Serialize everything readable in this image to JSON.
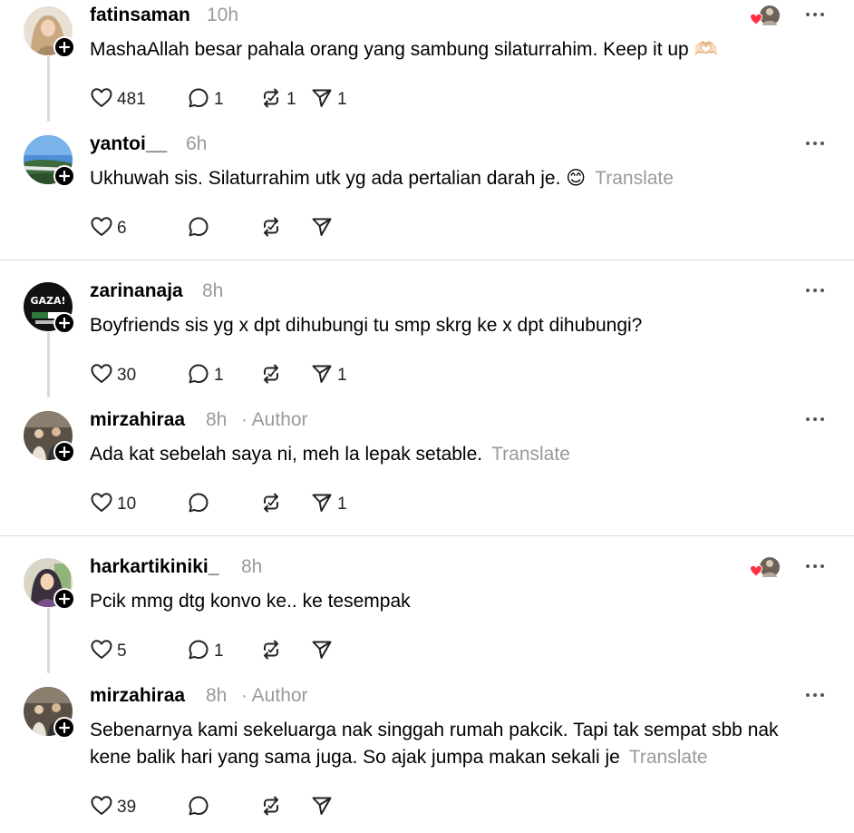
{
  "posts": [
    {
      "username": "fatinsaman",
      "time": "10h",
      "author_label": "",
      "text": "MashaAllah besar pahala orang yang sambung silaturrahim. Keep it up 🫶🏻",
      "translate": "",
      "likes": "481",
      "replies": "1",
      "reposts": "1",
      "shares": "1",
      "liked_by_author": true,
      "avatar": "avatar-hijab-woman"
    },
    {
      "username": "yantoi__",
      "time": "6h",
      "author_label": "",
      "text": "Ukhuwah sis. Silaturrahim utk yg ada pertalian darah je. 😊",
      "translate": "Translate",
      "likes": "6",
      "replies": "",
      "reposts": "",
      "shares": "",
      "liked_by_author": false,
      "avatar": "avatar-landscape"
    },
    {
      "username": "zarinanaja",
      "time": "8h",
      "author_label": "",
      "text": "Boyfriends sis yg x dpt dihubungi tu smp skrg ke x dpt dihubungi?",
      "translate": "",
      "likes": "30",
      "replies": "1",
      "reposts": "",
      "shares": "1",
      "liked_by_author": false,
      "avatar": "avatar-gaza-sign",
      "avatar_text": "GAZA!"
    },
    {
      "username": "mirzahiraa",
      "time": "8h",
      "author_label": "· Author",
      "text": "Ada kat sebelah saya ni, meh la lepak setable.",
      "translate": "Translate",
      "likes": "10",
      "replies": "",
      "reposts": "",
      "shares": "1",
      "liked_by_author": false,
      "avatar": "avatar-family-photo"
    },
    {
      "username": "harkartikiniki_",
      "time": "8h",
      "author_label": "",
      "text": "Pcik mmg dtg konvo ke.. ke tesempak",
      "translate": "",
      "likes": "5",
      "replies": "1",
      "reposts": "",
      "shares": "",
      "liked_by_author": true,
      "avatar": "avatar-woman-portrait"
    },
    {
      "username": "mirzahiraa",
      "time": "8h",
      "author_label": "· Author",
      "text": "Sebenarnya kami sekeluarga nak singgah rumah pakcik. Tapi tak sempat sbb nak kene balik hari yang sama juga. So ajak jumpa makan sekali je",
      "translate": "Translate",
      "likes": "39",
      "replies": "",
      "reposts": "",
      "shares": "",
      "liked_by_author": false,
      "avatar": "avatar-family-photo"
    }
  ],
  "colors": {
    "text": "#000000",
    "muted": "#9a9a9a",
    "divider": "#dcdcdc",
    "thread_line": "#d9d9d9",
    "heart_red": "#ff3040"
  }
}
